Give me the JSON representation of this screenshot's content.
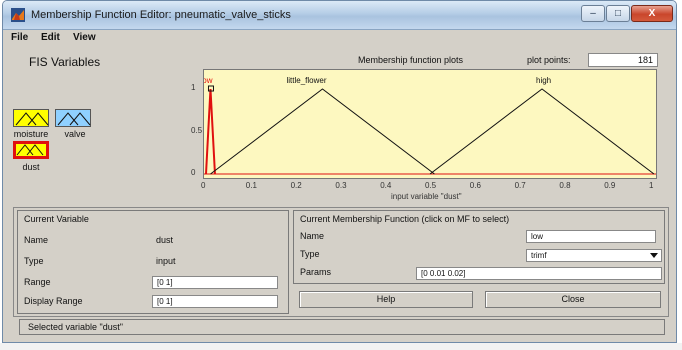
{
  "window": {
    "title": "Membership Function Editor: pneumatic_valve_sticks",
    "minimize": "–",
    "maximize": "□",
    "close": "X"
  },
  "menu": {
    "file": "File",
    "edit": "Edit",
    "view": "View"
  },
  "fis": {
    "title": "FIS Variables",
    "inputs": [
      {
        "label": "moisture",
        "type": "input"
      },
      {
        "label": "dust",
        "type": "input",
        "selected": true
      }
    ],
    "outputs": [
      {
        "label": "valve",
        "type": "output"
      }
    ]
  },
  "plot": {
    "title": "Membership function plots",
    "points_label": "plot points:",
    "points_value": "181",
    "xlabel": "input variable \"dust\""
  },
  "chart_data": {
    "type": "line",
    "title": "Membership function plots",
    "xlabel": "input variable \"dust\"",
    "ylabel": "",
    "xlim": [
      0,
      1
    ],
    "ylim": [
      0,
      1
    ],
    "x_ticks": [
      "0",
      "0.1",
      "0.2",
      "0.3",
      "0.4",
      "0.5",
      "0.6",
      "0.7",
      "0.8",
      "0.9",
      "1"
    ],
    "y_ticks": [
      "0",
      "0.5",
      "1"
    ],
    "grid": false,
    "series": [
      {
        "name": "low",
        "x": [
          0,
          0.01,
          0.02
        ],
        "y": [
          0,
          1,
          0
        ],
        "color": "#e0100f"
      },
      {
        "name": "little_flower",
        "x": [
          0.01,
          0.26,
          0.51
        ],
        "y": [
          0,
          1,
          0
        ],
        "color": "#111111"
      },
      {
        "name": "high",
        "x": [
          0.5,
          0.75,
          1.0
        ],
        "y": [
          0,
          1,
          0
        ],
        "color": "#111111"
      }
    ]
  },
  "current_variable": {
    "title": "Current Variable",
    "name_label": "Name",
    "name_value": "dust",
    "type_label": "Type",
    "type_value": "input",
    "range_label": "Range",
    "range_value": "[0 1]",
    "display_range_label": "Display Range",
    "display_range_value": "[0 1]"
  },
  "current_mf": {
    "title": "Current Membership Function (click on MF to select)",
    "name_label": "Name",
    "name_value": "low",
    "type_label": "Type",
    "type_value": "trimf",
    "params_label": "Params",
    "params_value": "[0 0.01 0.02]"
  },
  "buttons": {
    "help": "Help",
    "close": "Close"
  },
  "status": "Selected variable \"dust\""
}
